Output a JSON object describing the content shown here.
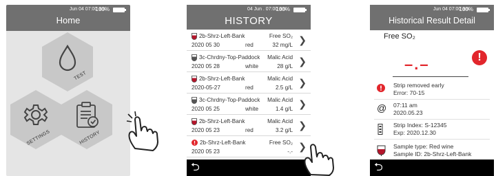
{
  "home": {
    "status_time": "Jun 04 07:00 am",
    "battery": "100%",
    "title": "Home",
    "tiles": {
      "test": "TEST",
      "settings": "SETTINGS",
      "history": "HISTORY"
    }
  },
  "history": {
    "status_time": "04 Jun . 07:00 am",
    "battery": "100%",
    "title": "HISTORY",
    "rows": [
      {
        "name": "2b-Shrz-Left-Bank",
        "param": "Free SO₂",
        "date": "2020 05 30",
        "color": "red",
        "value": "32 mg/L",
        "icon": "wine-glass-red-icon"
      },
      {
        "name": "3c-Chrdny-Top-Paddock",
        "param": "Malic Acid",
        "date": "2020 05 28",
        "color": "white",
        "value": "28 g/L",
        "icon": "wine-glass-white-icon"
      },
      {
        "name": "2b-Shrz-Left-Bank",
        "param": "Malic Acid",
        "date": "2020-05-27",
        "color": "red",
        "value": "2.5 g/L",
        "icon": "wine-glass-red-icon"
      },
      {
        "name": "3c-Chrdny-Top-Paddock",
        "param": "Malic Acid",
        "date": "2020 05 25",
        "color": "white",
        "value": "1.4 g/L",
        "icon": "wine-glass-white-icon"
      },
      {
        "name": "2b-Shrz-Left-Bank",
        "param": "Malic Acid",
        "date": "2020 05 23",
        "color": "red",
        "value": "3.2 g/L",
        "icon": "wine-glass-red-icon"
      },
      {
        "name": "2b-Shrz-Left-Bank",
        "param": "Free SO₂",
        "date": "2020 05 23",
        "color": "",
        "value": "-.-",
        "icon": "error-icon"
      }
    ],
    "back": "⮌"
  },
  "detail": {
    "status_time": "Jun 04 07:00 am",
    "battery": "100%",
    "title": "Historical Result Detail",
    "parameter": "Free SO₂",
    "result": "–.–",
    "error_line1": "Strip removed early",
    "error_line2": "Error: 70-15",
    "time_line1": "07:11 am",
    "time_line2": "2020.05.23",
    "strip_line1": "Strip Index: S-12345",
    "strip_line2": "Exp: 2020.12.30",
    "sample_line1": "Sample type: Red wine",
    "sample_line2": "Sample ID: 2b-Shrz-Left-Bank",
    "back": "⮌"
  },
  "colors": {
    "topbar": "#707070",
    "error_red": "#e2262c",
    "wine_red": "#b5152b",
    "hex_grey": "#c8c8c8"
  }
}
